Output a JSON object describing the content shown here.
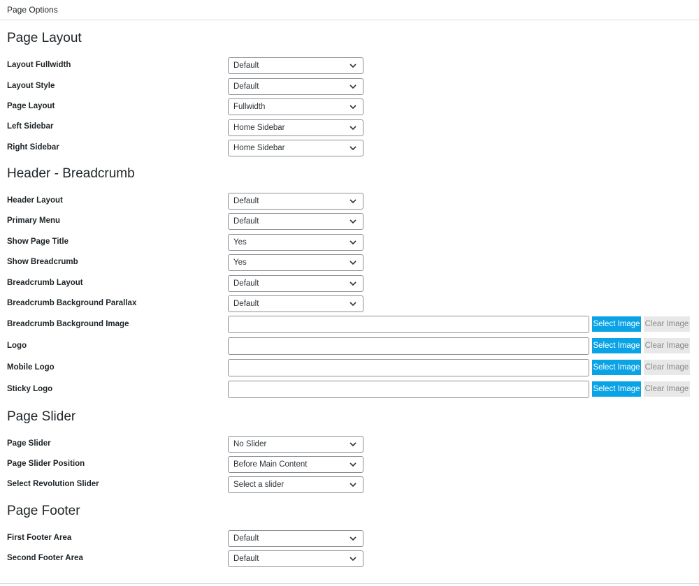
{
  "panel": {
    "title": "Page Options"
  },
  "sections": {
    "layout": "Page Layout",
    "header": "Header - Breadcrumb",
    "slider": "Page Slider",
    "footer": "Page Footer"
  },
  "fields": {
    "layout_fullwidth": {
      "label": "Layout Fullwidth",
      "value": "Default"
    },
    "layout_style": {
      "label": "Layout Style",
      "value": "Default"
    },
    "page_layout": {
      "label": "Page Layout",
      "value": "Fullwidth"
    },
    "left_sidebar": {
      "label": "Left Sidebar",
      "value": "Home Sidebar"
    },
    "right_sidebar": {
      "label": "Right Sidebar",
      "value": "Home Sidebar"
    },
    "header_layout": {
      "label": "Header Layout",
      "value": "Default"
    },
    "primary_menu": {
      "label": "Primary Menu",
      "value": "Default"
    },
    "show_page_title": {
      "label": "Show Page Title",
      "value": "Yes"
    },
    "show_breadcrumb": {
      "label": "Show Breadcrumb",
      "value": "Yes"
    },
    "breadcrumb_layout": {
      "label": "Breadcrumb Layout",
      "value": "Default"
    },
    "breadcrumb_bg_parallax": {
      "label": "Breadcrumb Background Parallax",
      "value": "Default"
    },
    "breadcrumb_bg_image": {
      "label": "Breadcrumb Background Image",
      "value": ""
    },
    "logo": {
      "label": "Logo",
      "value": ""
    },
    "mobile_logo": {
      "label": "Mobile Logo",
      "value": ""
    },
    "sticky_logo": {
      "label": "Sticky Logo",
      "value": ""
    },
    "page_slider": {
      "label": "Page Slider",
      "value": "No Slider"
    },
    "page_slider_position": {
      "label": "Page Slider Position",
      "value": "Before Main Content"
    },
    "revolution_slider": {
      "label": "Select Revolution Slider",
      "value": "Select a slider"
    },
    "first_footer_area": {
      "label": "First Footer Area",
      "value": "Default"
    },
    "second_footer_area": {
      "label": "Second Footer Area",
      "value": "Default"
    }
  },
  "buttons": {
    "select_image": "Select Image",
    "clear_image": "Clear Image"
  },
  "colors": {
    "select_button": "#0aa3e6",
    "clear_button": "#e8e8e8"
  },
  "icons": {
    "dropdown": "chevron-down-icon"
  }
}
